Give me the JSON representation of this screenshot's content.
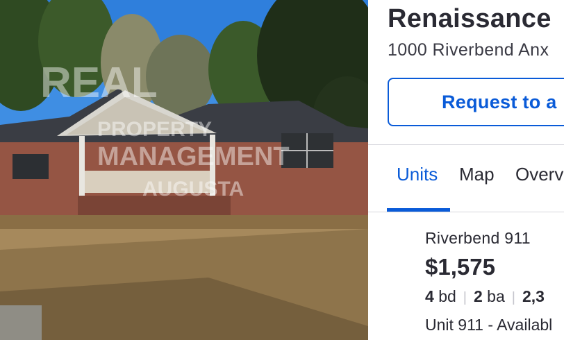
{
  "photo": {
    "watermark_line1": "REAL",
    "watermark_line2": "PROPERTY",
    "watermark_line3": "MANAGEMENT",
    "watermark_line4": "AUGUSTA"
  },
  "listing": {
    "title": "Renaissance",
    "address": "1000 Riverbend Anx",
    "tour_button_label": "Request to a"
  },
  "tabs": [
    {
      "label": "Units",
      "active": true
    },
    {
      "label": "Map",
      "active": false
    },
    {
      "label": "Overv",
      "active": false
    }
  ],
  "unit": {
    "name": "Riverbend 911",
    "price": "$1,575",
    "beds_value": "4",
    "beds_unit": "bd",
    "baths_value": "2",
    "baths_unit": "ba",
    "sqft_partial": "2,3",
    "availability": "Unit 911 - Availabl"
  },
  "colors": {
    "accent": "#0a5bd8",
    "text": "#2a2a33",
    "divider": "#d6d6dc"
  }
}
